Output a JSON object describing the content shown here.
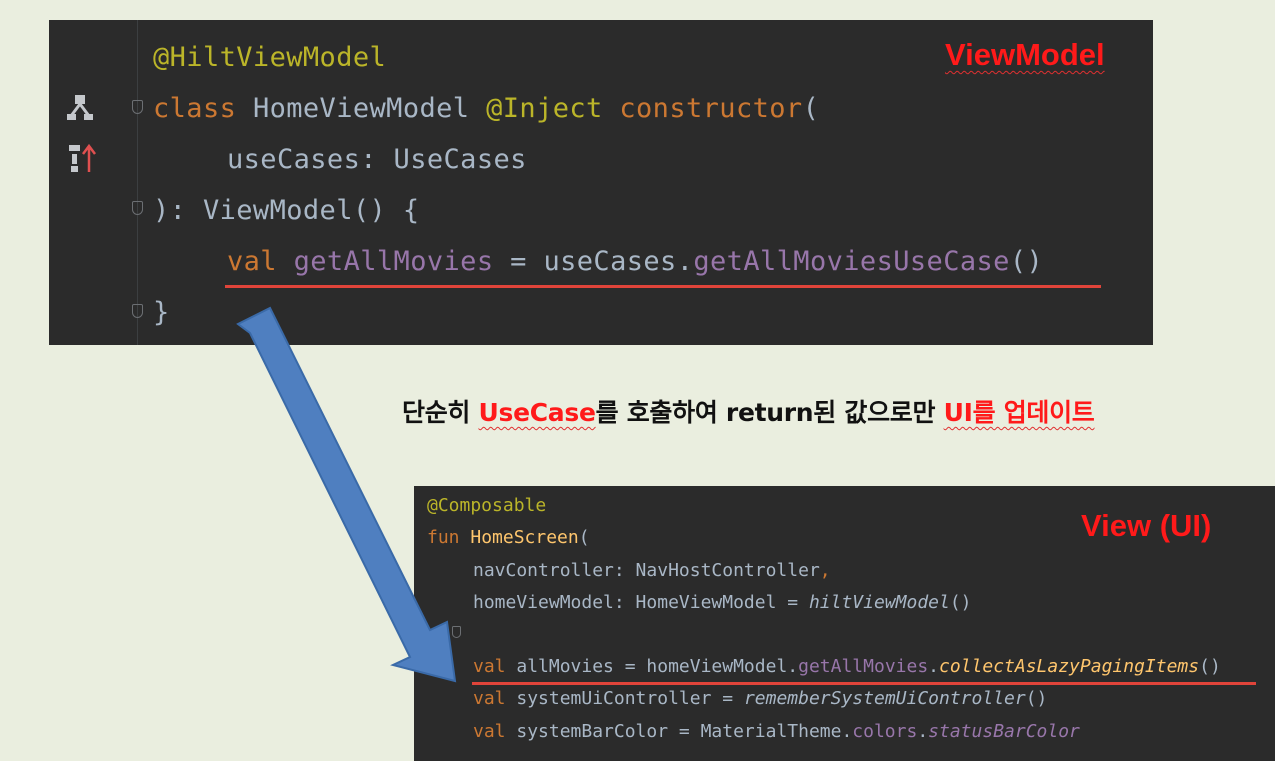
{
  "viewmodel_panel": {
    "label": "ViewModel",
    "lines": {
      "annotation": "@HiltViewModel",
      "class_kw": "class",
      "class_name": "HomeViewModel",
      "inject": "@Inject",
      "constructor_kw": "constructor",
      "paren_open": "(",
      "param_name": "useCases",
      "param_type": ": UseCases",
      "close_sig": "): ViewModel() {",
      "val_kw": "val",
      "prop_name": "getAllMovies",
      "assign": " = useCases.",
      "call_name": "getAllMoviesUseCase",
      "call_parens": "()",
      "close_brace": "}"
    }
  },
  "caption": {
    "part1": "단순히 ",
    "usecase": "UseCase",
    "part2": "를 호출하여 return된 값으로만 ",
    "ui": "UI를 업데이트"
  },
  "ui_panel": {
    "label": "View (UI)",
    "lines": {
      "annotation": "@Composable",
      "fun_kw": "fun",
      "fun_name": "HomeScreen",
      "paren_open": "(",
      "nav_param": "navController: NavHostController",
      "comma": ",",
      "vm_param": "homeViewModel: HomeViewModel = ",
      "hilt_call": "hiltViewModel",
      "hilt_parens": "()",
      "val_kw": "val",
      "all_movies_lhs": " allMovies = homeViewModel.",
      "all_movies_prop": "getAllMovies",
      "dot": ".",
      "collect_call": "collectAsLazyPagingItems",
      "collect_parens": "()",
      "sys_ui_lhs": " systemUiController = ",
      "sys_ui_call": "rememberSystemUiController",
      "sys_ui_parens": "()",
      "sys_bar_lhs": " systemBarColor = MaterialTheme.",
      "sys_bar_colors": "colors",
      "sys_bar_status": "statusBarColor"
    }
  },
  "colors": {
    "accent_red": "#ff1a1a",
    "arrow_blue": "#4f7fc0",
    "editor_bg": "#2b2b2b"
  },
  "icons": [
    "hierarchy-icon",
    "override-icon",
    "fold-icon",
    "arrow-icon"
  ]
}
